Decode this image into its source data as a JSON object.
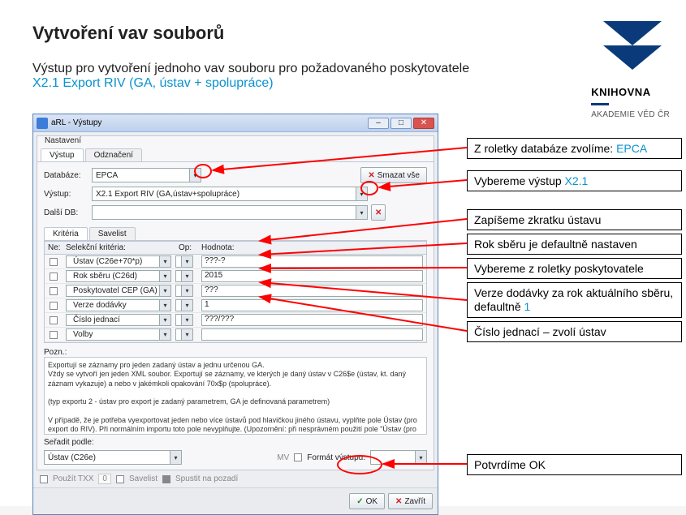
{
  "heading": "Vytvoření vav souborů",
  "subtitle": {
    "line1": "Výstup pro vytvoření jednoho vav souboru pro požadovaného poskytovatele",
    "line2": "X2.1 Export RIV (GA, ústav + spolupráce)"
  },
  "logo": {
    "l1": "KNIHOVNA",
    "l2": "AKADEMIE VĚD ČR"
  },
  "win": {
    "title": "aRL - Výstupy",
    "group": "Nastavení",
    "tabs": {
      "t1": "Výstup",
      "t2": "Odznačení"
    },
    "labels": {
      "databaze": "Databáze:",
      "vystup": "Výstup:",
      "dalsidb": "Další DB:"
    },
    "values": {
      "databaze": "EPCA",
      "vystup": "X2.1 Export RIV (GA,ústav+spolupráce)"
    },
    "smazat": "Smazat vše",
    "tabs2": {
      "t1": "Kritéria",
      "t2": "Savelist"
    },
    "grid": {
      "h_ne": "Ne:",
      "h_sel": "Selekční kritéria:",
      "h_op": "Op:",
      "h_val": "Hodnota:",
      "rows": [
        {
          "sel": "Ústav (C26e+70*p)",
          "op": "=",
          "val": "???-?"
        },
        {
          "sel": "Rok sběru (C26d)",
          "op": "=",
          "val": "2015"
        },
        {
          "sel": "Poskytovatel CEP (GA)",
          "op": "=",
          "val": "???"
        },
        {
          "sel": "Verze dodávky",
          "op": "=",
          "val": "1"
        },
        {
          "sel": "Číslo jednací",
          "op": "=",
          "val": "???/???"
        },
        {
          "sel": "Volby",
          "op": "=",
          "val": ""
        }
      ]
    },
    "pozn_label": "Pozn.:",
    "pozn_text": "Exportují se záznamy pro jeden zadaný ústav a jednu určenou GA.\nVždy se vytvoří jen jeden XML soubor. Exportují se záznamy, ve kterých je daný ústav v C26$e (ústav, kt. daný záznam vykazuje) a nebo v jakémkoli opakování 70x$p (spolupráce).\n\n(typ exportu 2 - ústav pro export je zadaný parametrem, GA je definovaná parametrem)\n\nV případě, že je potřeba vyexportovat jeden nebo více ústavů pod hlavičkou jiného ústavu, vyplňte pole Ústav (pro export do RIV). Při normálním importu toto pole nevyplňujte. (Upozornění: při nesprávném použití pole \"Ústav (pro export do RIV)\" je možné, že výstup bude nesmyslný.)\nPříklad: Ústav=PAU-O~UMBR-M~UPB-H~ENTU-I~HBU-Z, Ústav (pro export do RIV)=BC-A",
    "seradit_label": "Seřadit podle:",
    "seradit_val": "Ústav (C26e)",
    "mv_label": "MV",
    "format_label": "Formát výstupu:",
    "opts": {
      "txx": "Použít TXX",
      "savelist": "Savelist",
      "bg": "Spustit na pozadí",
      "zero": "0"
    },
    "btn_ok": "OK",
    "btn_close": "Zavřít"
  },
  "callouts": {
    "c1a": "Z roletky databáze zvolíme: ",
    "c1b": "EPCA",
    "c2a": "Vybereme výstup ",
    "c2b": "X2.1",
    "c3": "Zapíšeme zkratku ústavu",
    "c4": "Rok sběru je defaultně nastaven",
    "c5": "Vybereme z roletky poskytovatele",
    "c6a": "Verze dodávky za rok aktuálního sběru, defaultně ",
    "c6b": "1",
    "c7": "Číslo jednací – zvolí ústav",
    "c8": "Potvrdíme OK"
  }
}
